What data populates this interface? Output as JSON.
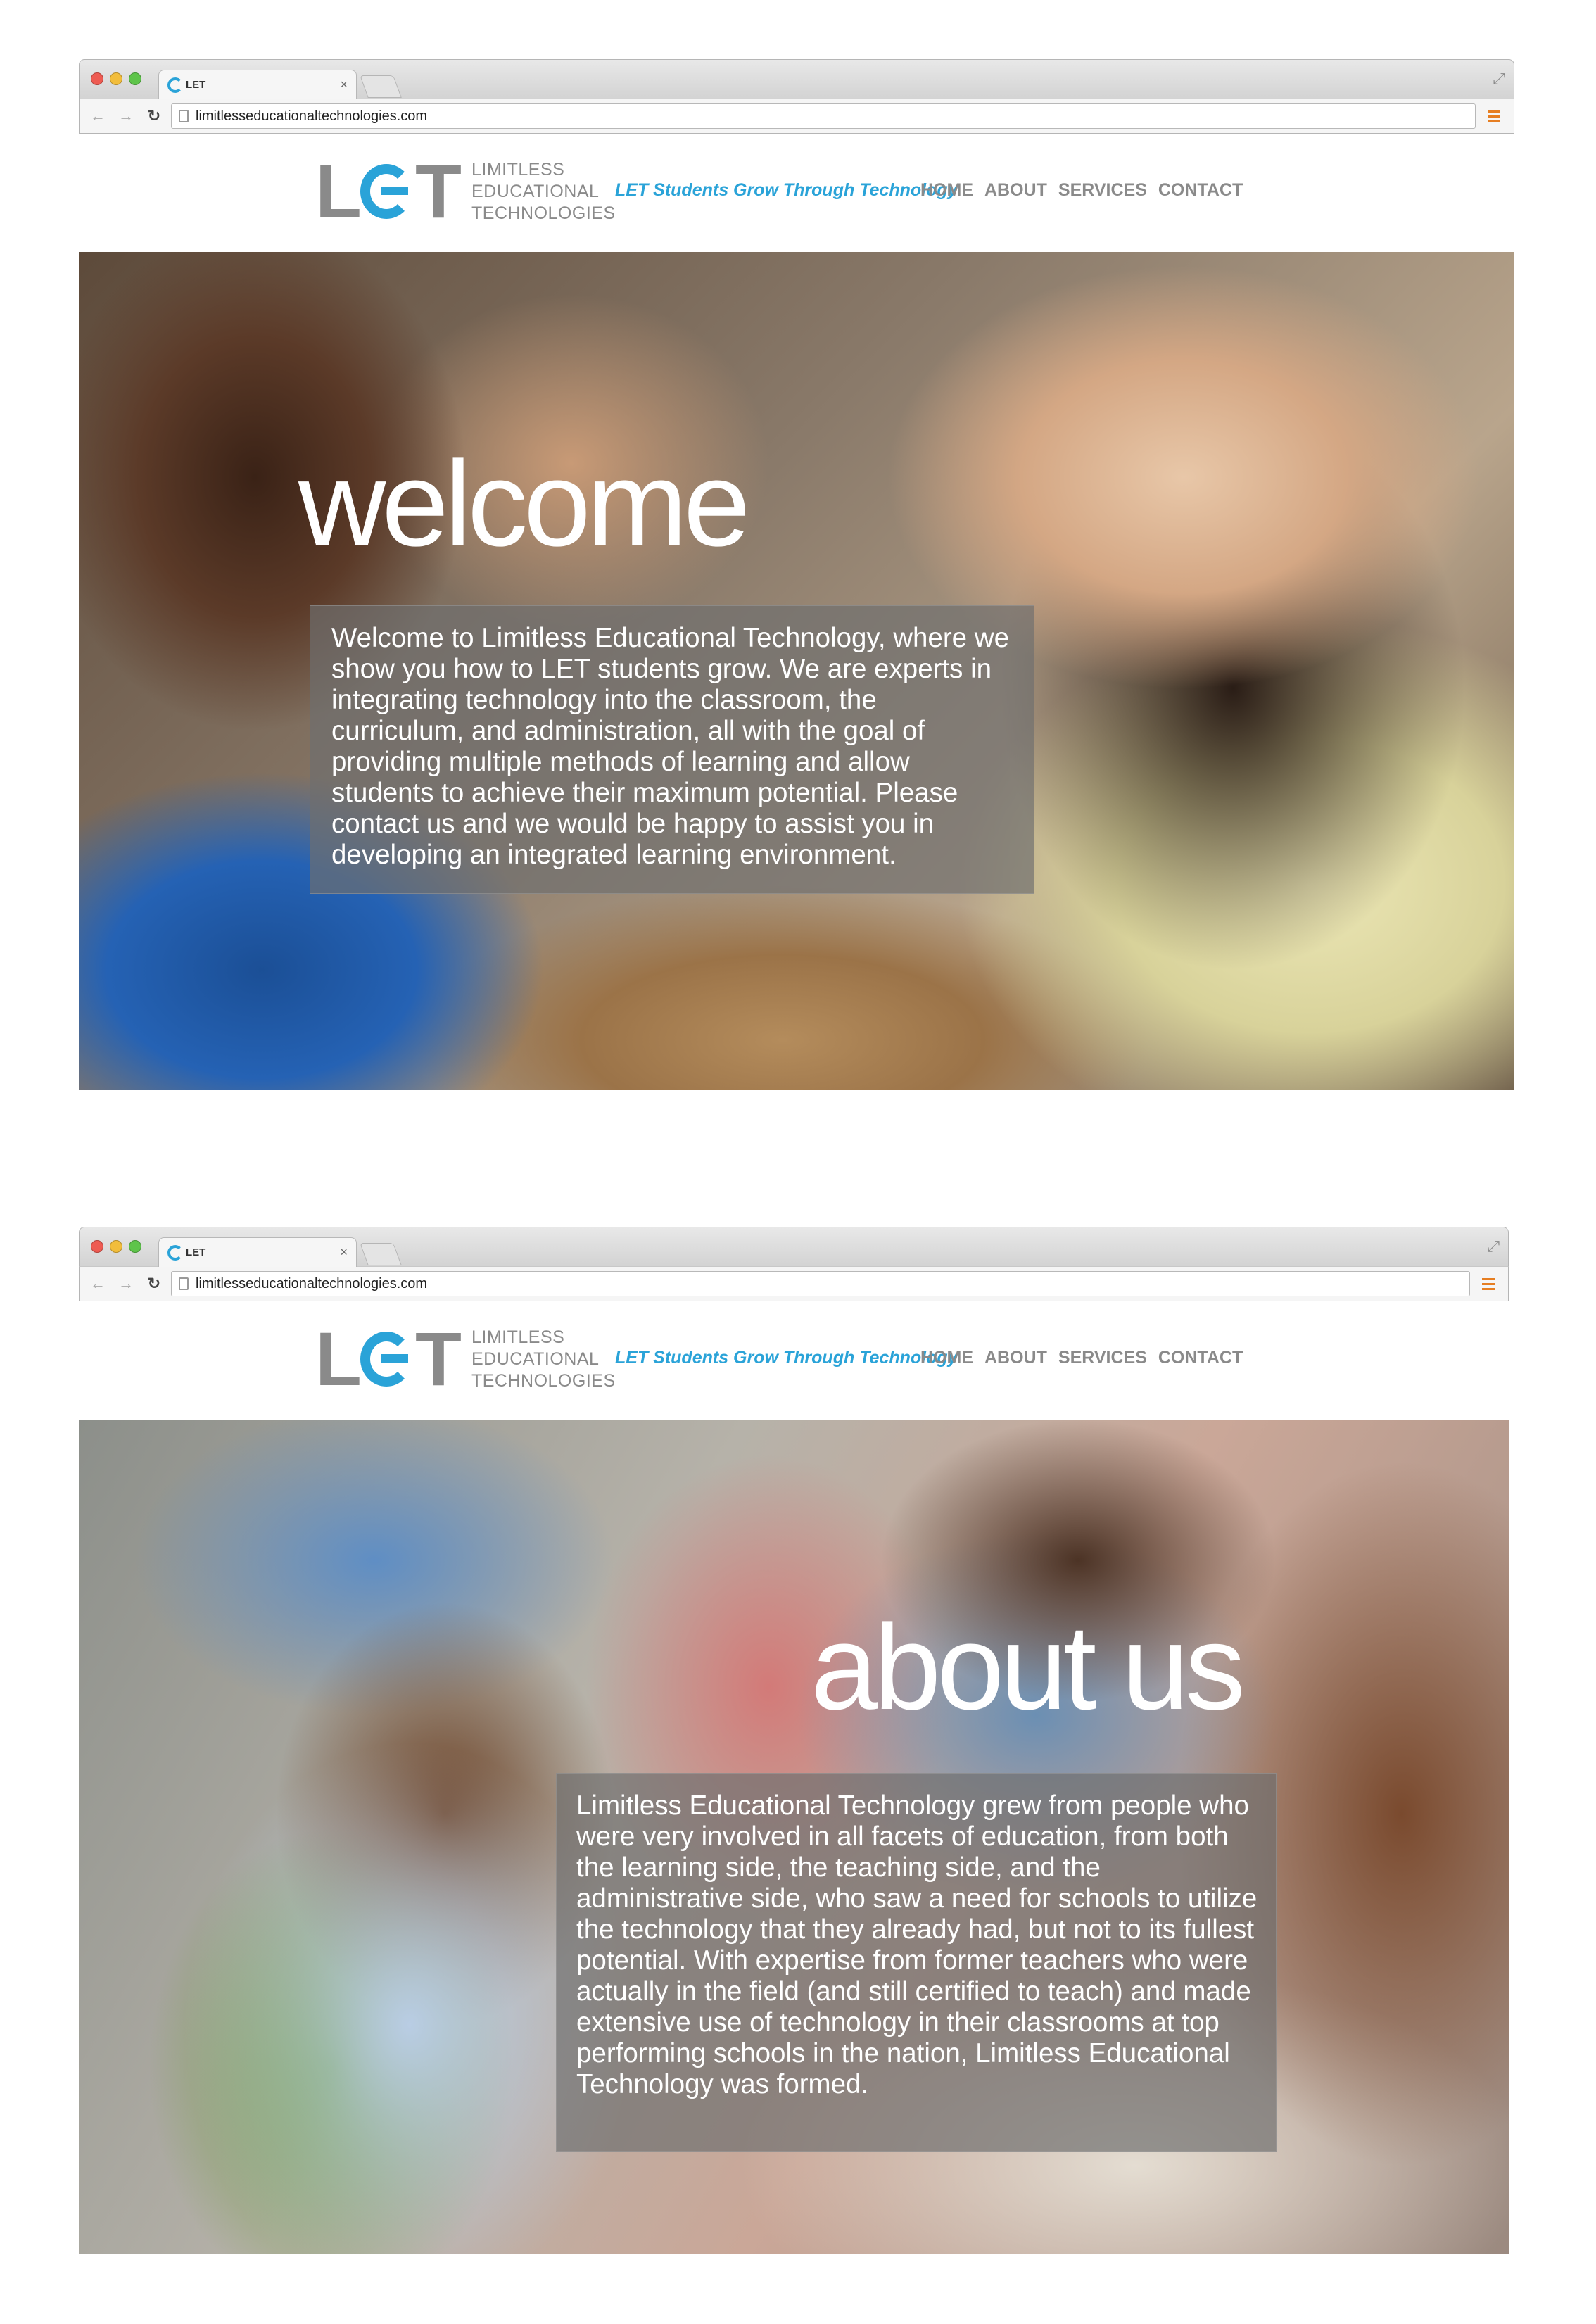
{
  "browser": {
    "tab_title": "LET",
    "url": "limitlesseducationaltechnologies.com",
    "tab_close": "×"
  },
  "site": {
    "logo_mark": "LET",
    "logo_lines": [
      "LIMITLESS",
      "EDUCATIONAL",
      "TECHNOLOGIES"
    ],
    "tagline": "LET Students Grow Through Technology",
    "nav": [
      "HOME",
      "ABOUT",
      "SERVICES",
      "CONTACT"
    ]
  },
  "welcome": {
    "title": "welcome",
    "body": "Welcome to Limitless Educational Technology, where we show you how to LET students grow. We are experts in integrating technology into the classroom, the curriculum, and administration, all with the goal of providing multiple methods of learning and allow students to achieve their maximum potential. Please contact us and we would be happy to assist you in developing an integrated learning environment."
  },
  "about": {
    "title": "about us",
    "body": "Limitless Educational Technology grew from people who were very involved in all facets of education, from both the learning side, the teaching side, and the administrative side, who saw a need for schools to utilize the technology that they already had, but not to its fullest potential. With expertise from former teachers who were actually in the field (and still certified to teach) and made extensive use of technology in their classrooms at top performing schools in the nation, Limitless Educational Technology was formed."
  },
  "colors": {
    "accent": "#2aa3d8",
    "nav_gray": "#8a8a8a",
    "menu_orange": "#e67e22"
  }
}
